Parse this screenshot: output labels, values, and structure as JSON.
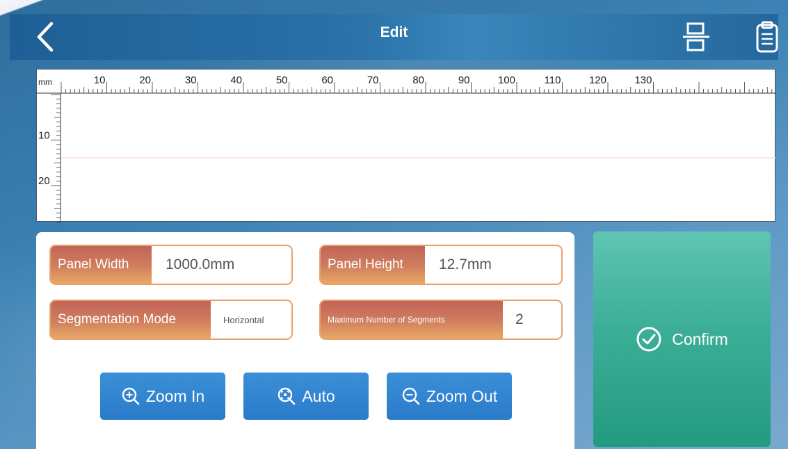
{
  "header": {
    "title": "Edit",
    "icons": [
      "back-icon",
      "split-panel-icon",
      "clipboard-icon"
    ]
  },
  "ruler": {
    "unit": "mm",
    "top_labels": [
      "10",
      "20",
      "30",
      "40",
      "50",
      "60",
      "70",
      "80",
      "90",
      "100",
      "110",
      "120",
      "130"
    ],
    "side_labels": [
      "10",
      "20"
    ]
  },
  "fields": {
    "panel_width": {
      "label": "Panel Width",
      "value": "1000.0mm"
    },
    "panel_height": {
      "label": "Panel Height",
      "value": "12.7mm"
    },
    "segmentation_mode": {
      "label": "Segmentation Mode",
      "value": "Horizontal"
    },
    "max_segments": {
      "label": "Maximum Number of Segments",
      "value": "2"
    }
  },
  "buttons": {
    "zoom_in": "Zoom In",
    "auto": "Auto",
    "zoom_out": "Zoom Out",
    "confirm": "Confirm"
  },
  "colors": {
    "header": "#24679d",
    "field_label": "#d07f5d",
    "field_border": "#e7a16c",
    "button_blue": "#2a7bc9",
    "confirm_green": "#3cae97",
    "divider_line": "#f3c9c9"
  }
}
